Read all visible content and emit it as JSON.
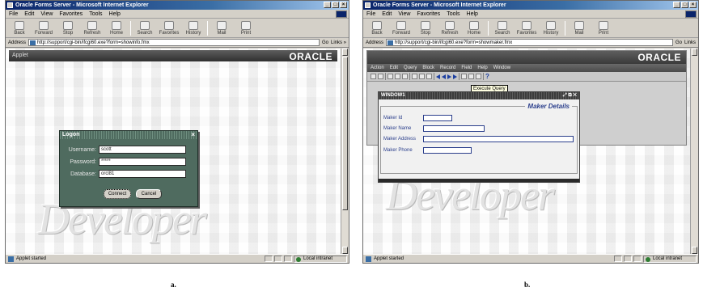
{
  "screenshots": {
    "a": {
      "window_title": "Oracle Forms Server - Microsoft Internet Explorer",
      "menu": [
        "File",
        "Edit",
        "View",
        "Favorites",
        "Tools",
        "Help"
      ],
      "toolbar": [
        "Back",
        "Forward",
        "Stop",
        "Refresh",
        "Home",
        "Search",
        "Favorites",
        "History",
        "Mail",
        "Print"
      ],
      "address_label": "Address",
      "address_url": "http://support/cgi-bin/ifcgi60.exe?form=showinfo.fmx",
      "go_label": "Go",
      "links_label": "Links »",
      "applet_label": "Applet",
      "oracle_logo": "ORACLE",
      "watermark": "Developer",
      "login": {
        "title": "Logon",
        "close": "×",
        "username_label": "Username:",
        "username_value": "scott",
        "password_label": "Password:",
        "password_value": "*****",
        "database_label": "Database:",
        "database_value": "orcl81",
        "connect_label": "Connect",
        "cancel_label": "Cancel"
      },
      "status_text": "Applet started",
      "zone": "Local intranet"
    },
    "b": {
      "window_title": "Oracle Forms Server - Microsoft Internet Explorer",
      "menu": [
        "File",
        "Edit",
        "View",
        "Favorites",
        "Tools",
        "Help"
      ],
      "toolbar": [
        "Back",
        "Forward",
        "Stop",
        "Refresh",
        "Home",
        "Search",
        "Favorites",
        "History",
        "Mail",
        "Print"
      ],
      "address_label": "Address",
      "address_url": "http://support/cgi-bin/ifcgi60.exe?form=showmaker.fmx",
      "go_label": "Go",
      "links_label": "Links",
      "oracle_logo": "ORACLE",
      "watermark": "Developer",
      "forms_menu": [
        "Action",
        "Edit",
        "Query",
        "Block",
        "Record",
        "Field",
        "Help",
        "Window"
      ],
      "tooltip": "Execute Query",
      "window1_title": "WINDOW1",
      "window1_controls": "⤢ ⧉ ✕",
      "maker_heading": "Maker Details",
      "fields": [
        "Maker Id",
        "Maker Name",
        "Maker Address",
        "Maker Phone"
      ],
      "status_text": "Applet started",
      "zone": "Local intranet"
    }
  },
  "captions": {
    "a": "a.",
    "b": "b."
  }
}
